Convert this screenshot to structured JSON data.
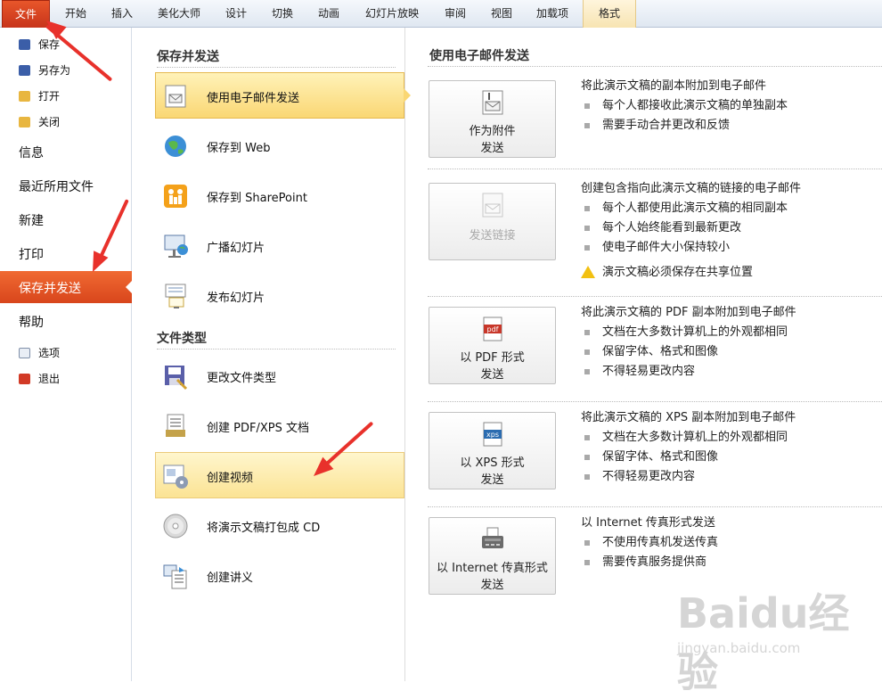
{
  "ribbon": {
    "tabs": [
      {
        "label": "文件"
      },
      {
        "label": "开始"
      },
      {
        "label": "插入"
      },
      {
        "label": "美化大师"
      },
      {
        "label": "设计"
      },
      {
        "label": "切换"
      },
      {
        "label": "动画"
      },
      {
        "label": "幻灯片放映"
      },
      {
        "label": "审阅"
      },
      {
        "label": "视图"
      },
      {
        "label": "加载项"
      },
      {
        "label": "格式"
      }
    ]
  },
  "leftnav": {
    "small_top": [
      {
        "label": "保存",
        "icon": "save-icon"
      },
      {
        "label": "另存为",
        "icon": "save-as-icon"
      },
      {
        "label": "打开",
        "icon": "open-folder-icon"
      },
      {
        "label": "关闭",
        "icon": "close-folder-icon"
      }
    ],
    "large": [
      {
        "label": "信息"
      },
      {
        "label": "最近所用文件"
      },
      {
        "label": "新建"
      },
      {
        "label": "打印"
      },
      {
        "label": "保存并发送",
        "active": true
      },
      {
        "label": "帮助"
      }
    ],
    "small_bottom": [
      {
        "label": "选项",
        "icon": "options-icon"
      },
      {
        "label": "退出",
        "icon": "exit-icon"
      }
    ]
  },
  "middle": {
    "section1_title": "保存并发送",
    "section2_title": "文件类型",
    "section1_items": [
      {
        "label": "使用电子邮件发送",
        "icon": "email-icon",
        "state": "selected"
      },
      {
        "label": "保存到 Web",
        "icon": "globe-icon"
      },
      {
        "label": "保存到 SharePoint",
        "icon": "sharepoint-icon"
      },
      {
        "label": "广播幻灯片",
        "icon": "broadcast-icon"
      },
      {
        "label": "发布幻灯片",
        "icon": "publish-slides-icon"
      }
    ],
    "section2_items": [
      {
        "label": "更改文件类型",
        "icon": "change-file-type-icon"
      },
      {
        "label": "创建 PDF/XPS 文档",
        "icon": "pdf-xps-icon"
      },
      {
        "label": "创建视频",
        "icon": "video-icon",
        "state": "hovered"
      },
      {
        "label": "将演示文稿打包成 CD",
        "icon": "cd-icon"
      },
      {
        "label": "创建讲义",
        "icon": "handout-icon"
      }
    ]
  },
  "right": {
    "title": "使用电子邮件发送",
    "options": [
      {
        "button_line1": "作为附件",
        "button_line2": "发送",
        "icon": "attachment-icon",
        "enabled": true,
        "heading": "将此演示文稿的副本附加到电子邮件",
        "bullets": [
          "每个人都接收此演示文稿的单独副本",
          "需要手动合并更改和反馈"
        ]
      },
      {
        "button_line1": "发送链接",
        "button_line2": "",
        "icon": "link-icon",
        "enabled": false,
        "heading": "创建包含指向此演示文稿的链接的电子邮件",
        "bullets": [
          "每个人都使用此演示文稿的相同副本",
          "每个人始终能看到最新更改",
          "使电子邮件大小保持较小"
        ],
        "warning": "演示文稿必须保存在共享位置"
      },
      {
        "button_line1": "以 PDF 形式",
        "button_line2": "发送",
        "icon": "pdf-icon",
        "enabled": true,
        "heading": "将此演示文稿的 PDF 副本附加到电子邮件",
        "bullets": [
          "文档在大多数计算机上的外观都相同",
          "保留字体、格式和图像",
          "不得轻易更改内容"
        ]
      },
      {
        "button_line1": "以 XPS 形式",
        "button_line2": "发送",
        "icon": "xps-icon",
        "enabled": true,
        "heading": "将此演示文稿的 XPS 副本附加到电子邮件",
        "bullets": [
          "文档在大多数计算机上的外观都相同",
          "保留字体、格式和图像",
          "不得轻易更改内容"
        ]
      },
      {
        "button_line1": "以 Internet 传真形式",
        "button_line2": "发送",
        "icon": "fax-icon",
        "enabled": true,
        "heading": "以 Internet 传真形式发送",
        "bullets": [
          "不使用传真机发送传真",
          "需要传真服务提供商"
        ]
      }
    ]
  },
  "watermark": {
    "brand": "Baidu经验",
    "url": "jingyan.baidu.com"
  },
  "colors": {
    "file_tab": "#c7341b",
    "active_nav": "#e8572a",
    "selected_item": "#fad774",
    "arrow": "#e8312b"
  }
}
